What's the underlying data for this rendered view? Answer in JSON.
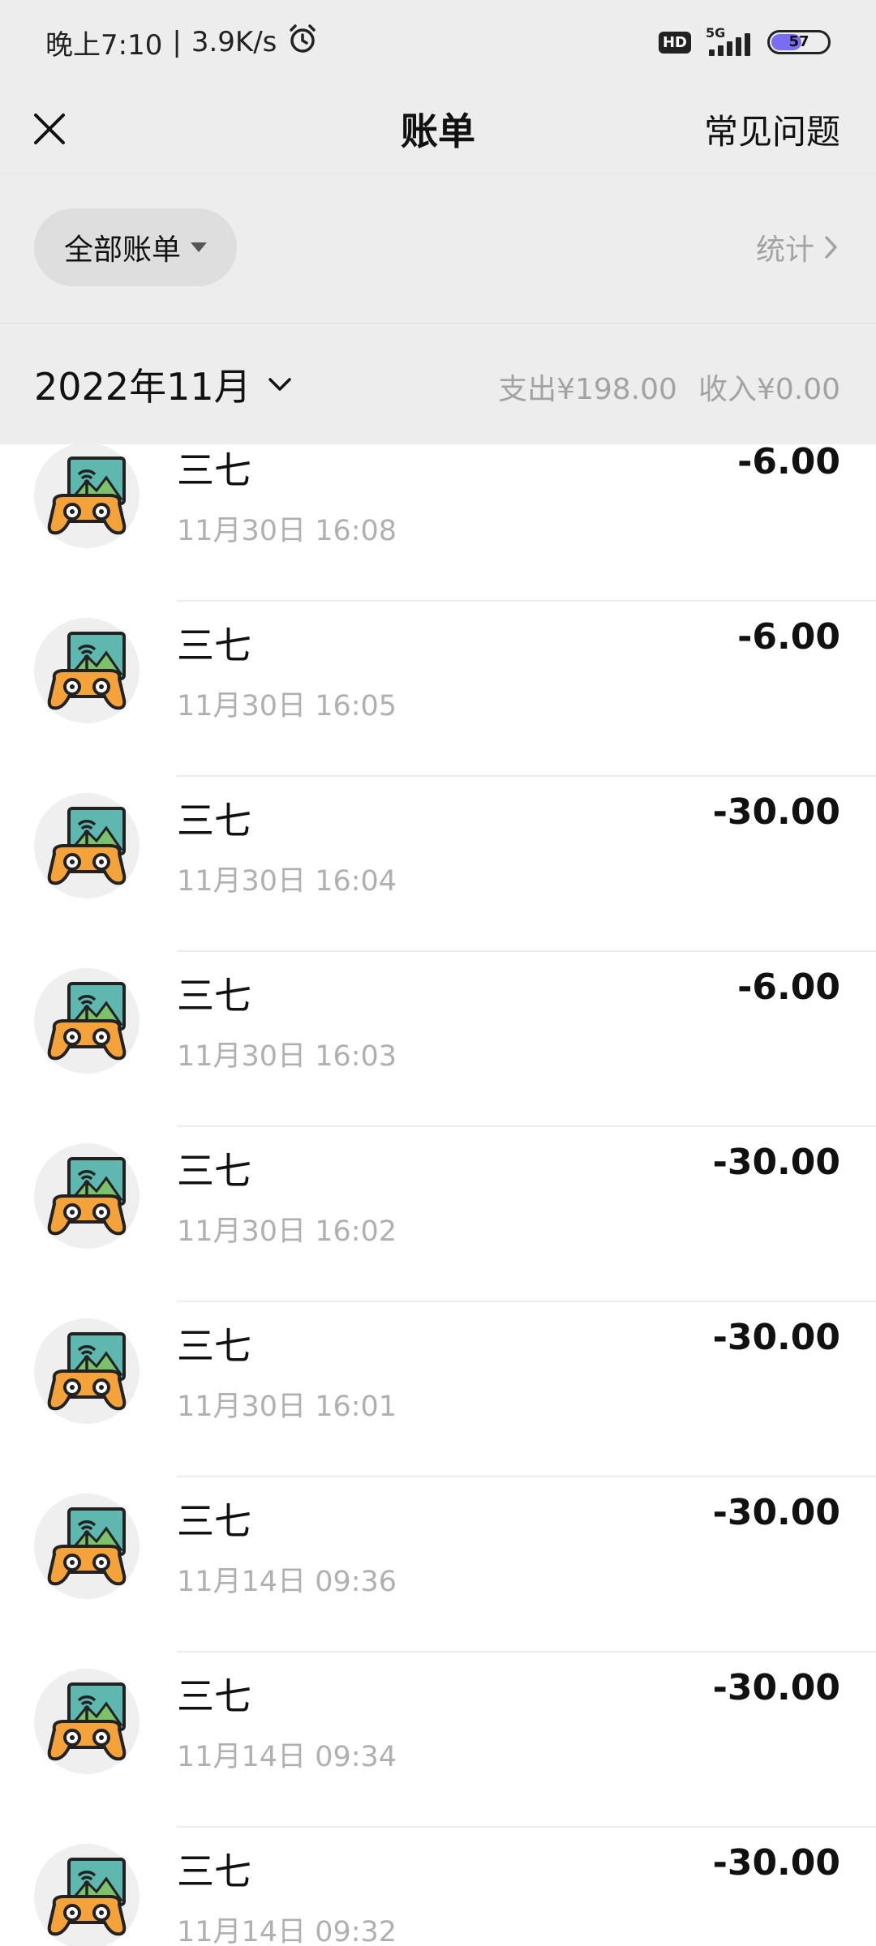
{
  "status_bar": {
    "time": "晚上7:10",
    "network_speed": "3.9K/s",
    "separator": "|",
    "hd_label": "HD",
    "network_type": "5G",
    "battery_percent": 57,
    "battery_label": "57",
    "icons": [
      "alarm-icon",
      "signal-icon",
      "battery-icon"
    ]
  },
  "nav": {
    "title": "账单",
    "faq_label": "常见问题",
    "close_icon": "close-icon"
  },
  "filter": {
    "all_bills_label": "全部账单",
    "stats_label": "统计"
  },
  "month_header": {
    "month_label": "2022年11月",
    "expense_label": "支出¥198.00",
    "income_label": "收入¥0.00"
  },
  "colors": {
    "header_bg": "#ededed",
    "muted_text": "#a3a3a3",
    "battery_fill": "#7b6cf5",
    "avatar_orange": "#f4a33b",
    "avatar_teal": "#5fb8b0",
    "avatar_green": "#7cc26a"
  },
  "transactions": [
    {
      "name": "三七",
      "time": "11月30日 16:08",
      "amount": "-6.00"
    },
    {
      "name": "三七",
      "time": "11月30日 16:05",
      "amount": "-6.00"
    },
    {
      "name": "三七",
      "time": "11月30日 16:04",
      "amount": "-30.00"
    },
    {
      "name": "三七",
      "time": "11月30日 16:03",
      "amount": "-6.00"
    },
    {
      "name": "三七",
      "time": "11月30日 16:02",
      "amount": "-30.00"
    },
    {
      "name": "三七",
      "time": "11月30日 16:01",
      "amount": "-30.00"
    },
    {
      "name": "三七",
      "time": "11月14日 09:36",
      "amount": "-30.00"
    },
    {
      "name": "三七",
      "time": "11月14日 09:34",
      "amount": "-30.00"
    },
    {
      "name": "三七",
      "time": "11月14日 09:32",
      "amount": "-30.00"
    }
  ]
}
